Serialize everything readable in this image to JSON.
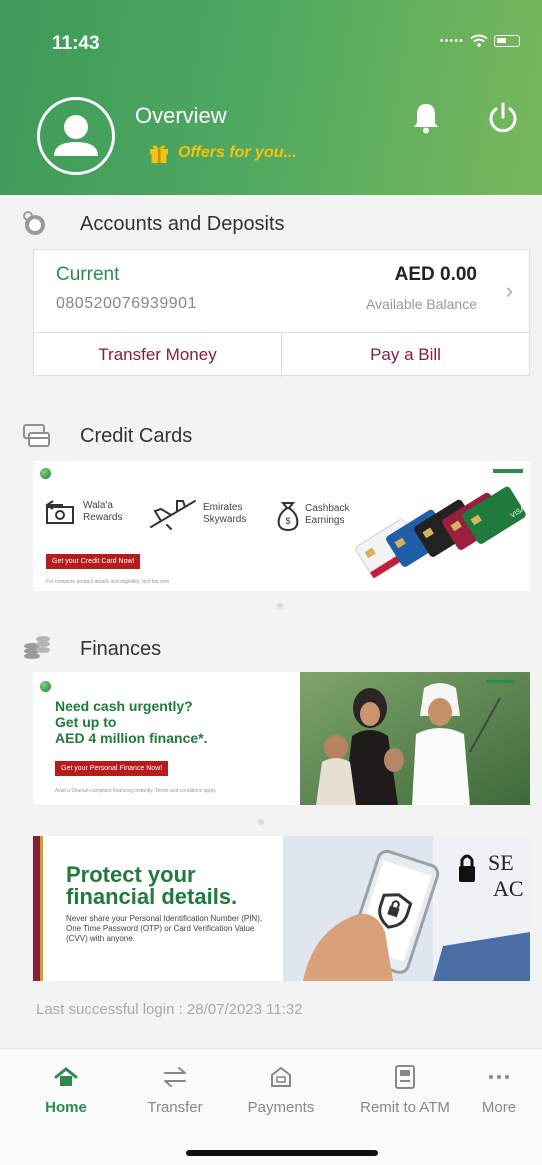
{
  "status_bar": {
    "time": "11:43"
  },
  "header": {
    "title": "Overview",
    "offers_label": "Offers for you..."
  },
  "sections": {
    "accounts": {
      "title": "Accounts and Deposits"
    },
    "credit_cards": {
      "title": "Credit Cards"
    },
    "finances": {
      "title": "Finances"
    }
  },
  "account": {
    "type": "Current",
    "number": "080520076939901",
    "balance": "AED 0.00",
    "balance_label": "Available Balance",
    "actions": [
      "Transfer Money",
      "Pay a Bill"
    ]
  },
  "credit_card_banner": {
    "features": [
      {
        "label": "Wala'a Rewards",
        "icon": "gift-box-icon"
      },
      {
        "label": "Emirates Skywards",
        "icon": "airplane-icon"
      },
      {
        "label": "Cashback Earnings",
        "icon": "money-bag-icon"
      }
    ],
    "cta": "Get your Credit Card Now!",
    "fine_print": "For complete product details and eligibility, visit fab.com"
  },
  "finance_banner": {
    "headline_lines": [
      "Need cash urgently?",
      "Get up to",
      "AED 4 million finance*."
    ],
    "cta": "Get your Personal Finance Now!",
    "fine_print": "Avail a Shariah-compliant financing instantly. Terms and conditions apply."
  },
  "security_banner": {
    "headline_lines": [
      "Protect your",
      "financial details."
    ],
    "body": "Never share your Personal Identification Number (PIN), One Time Password (OTP) or Card Verification Value (CVV) with anyone.",
    "photo_text_lines": [
      "SE",
      "AC"
    ]
  },
  "last_login": "Last successful login : 28/07/2023 11:32",
  "tabs": [
    {
      "label": "Home",
      "icon": "home-icon",
      "active": true
    },
    {
      "label": "Transfer",
      "icon": "transfer-arrows-icon",
      "active": false
    },
    {
      "label": "Payments",
      "icon": "payments-icon",
      "active": false
    },
    {
      "label": "Remit to ATM",
      "icon": "atm-icon",
      "active": false
    },
    {
      "label": "More",
      "icon": "more-dots-icon",
      "active": false
    }
  ],
  "colors": {
    "brand_green": "#2e8b4e",
    "accent_maroon": "#8a1c3c",
    "offers_gold": "#f1c40f",
    "cta_red": "#b71c1c"
  }
}
